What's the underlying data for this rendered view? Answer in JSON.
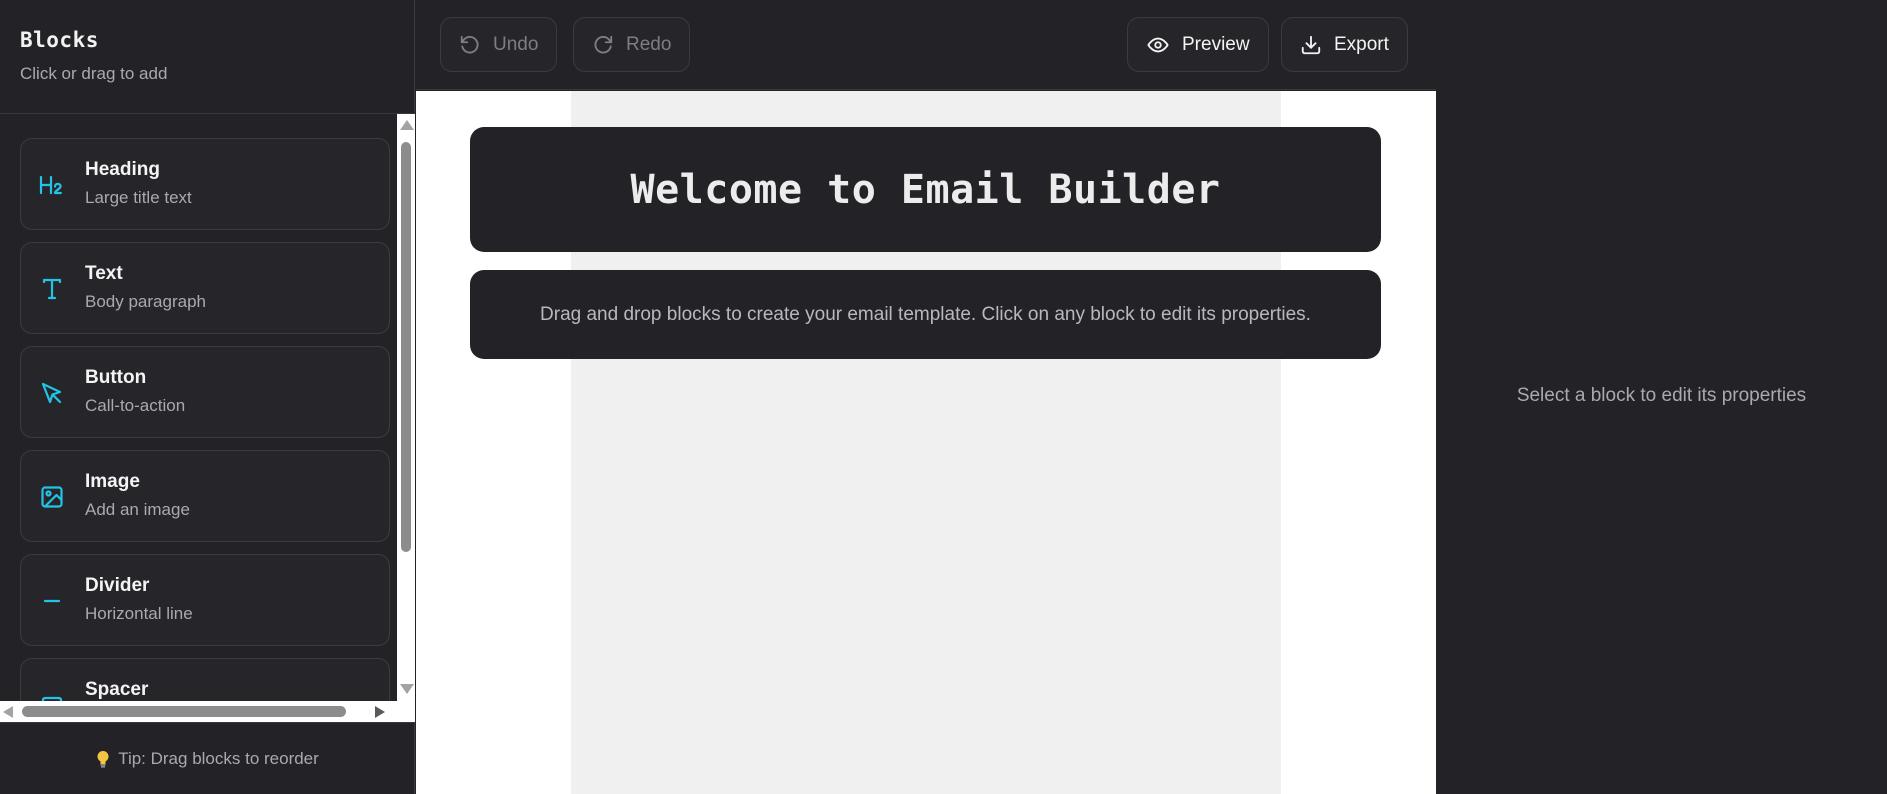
{
  "sidebar": {
    "title": "Blocks",
    "subtitle": "Click or drag to add",
    "items": [
      {
        "label": "Heading",
        "description": "Large title text",
        "icon": "heading-icon"
      },
      {
        "label": "Text",
        "description": "Body paragraph",
        "icon": "text-icon"
      },
      {
        "label": "Button",
        "description": "Call-to-action",
        "icon": "cursor-pointer-icon"
      },
      {
        "label": "Image",
        "description": "Add an image",
        "icon": "image-icon"
      },
      {
        "label": "Divider",
        "description": "Horizontal line",
        "icon": "divider-icon"
      },
      {
        "label": "Spacer",
        "description": "",
        "icon": "spacer-icon"
      }
    ],
    "footer_tip": "Tip: Drag blocks to reorder"
  },
  "toolbar": {
    "undo_label": "Undo",
    "redo_label": "Redo",
    "preview_label": "Preview",
    "export_label": "Export"
  },
  "canvas": {
    "heading": "Welcome to Email Builder",
    "text": "Drag and drop blocks to create your email template. Click on any block to edit its properties."
  },
  "properties": {
    "empty_message": "Select a block to edit its properties"
  },
  "colors": {
    "accent": "#22c3e6",
    "panel_bg": "#232327",
    "canvas_bg": "#ffffff",
    "email_bg": "#f0f0f0"
  }
}
